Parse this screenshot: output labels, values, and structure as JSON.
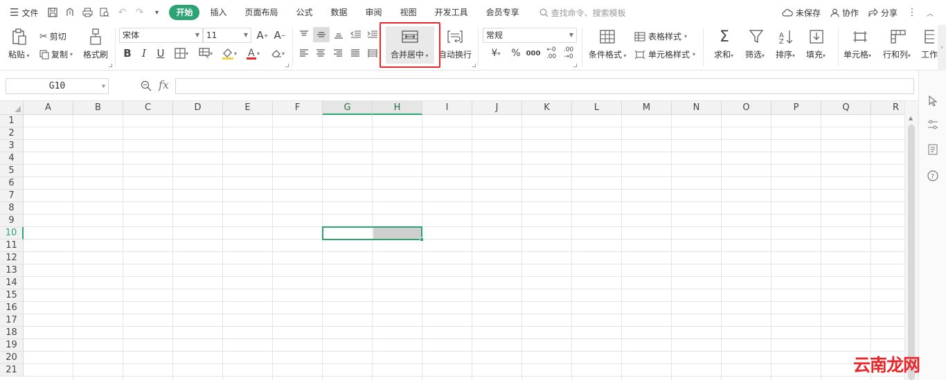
{
  "menubar": {
    "menu_label": "文件",
    "tabs": [
      {
        "label": "开始",
        "active": true
      },
      {
        "label": "插入"
      },
      {
        "label": "页面布局"
      },
      {
        "label": "公式"
      },
      {
        "label": "数据"
      },
      {
        "label": "审阅"
      },
      {
        "label": "视图"
      },
      {
        "label": "开发工具"
      },
      {
        "label": "会员专享"
      }
    ],
    "search_placeholder": "查找命令、搜索模板",
    "unsaved_label": "未保存",
    "collab_label": "协作",
    "share_label": "分享"
  },
  "ribbon": {
    "paste_label": "粘贴",
    "cut_label": "剪切",
    "copy_label": "复制",
    "format_painter_label": "格式刷",
    "font_name": "宋体",
    "font_size": "11",
    "merge_center_label": "合并居中",
    "wrap_text_label": "自动换行",
    "number_format": "常规",
    "conditional_format_label": "条件格式",
    "table_style_label": "表格样式",
    "cell_style_label": "单元格样式",
    "sum_label": "求和",
    "filter_label": "筛选",
    "sort_label": "排序",
    "fill_label": "填充",
    "cell_label": "单元格",
    "rowcol_label": "行和列",
    "worksheet_label": "工作",
    "highlight_color": "#e8262a",
    "accent_color": "#2ba471"
  },
  "formula_bar": {
    "name_box": "G10",
    "fx_label": "fx",
    "formula_value": ""
  },
  "grid": {
    "columns": [
      "A",
      "B",
      "C",
      "D",
      "E",
      "F",
      "G",
      "H",
      "I",
      "J",
      "K",
      "L",
      "M",
      "N",
      "O",
      "P",
      "Q",
      "R"
    ],
    "rows": [
      "1",
      "2",
      "3",
      "4",
      "5",
      "6",
      "7",
      "8",
      "9",
      "10",
      "11",
      "12",
      "13",
      "14",
      "15",
      "16",
      "17",
      "18",
      "19",
      "20",
      "21"
    ],
    "selected_columns": [
      "G",
      "H"
    ],
    "selected_row": "10"
  },
  "watermark": "云南龙网"
}
